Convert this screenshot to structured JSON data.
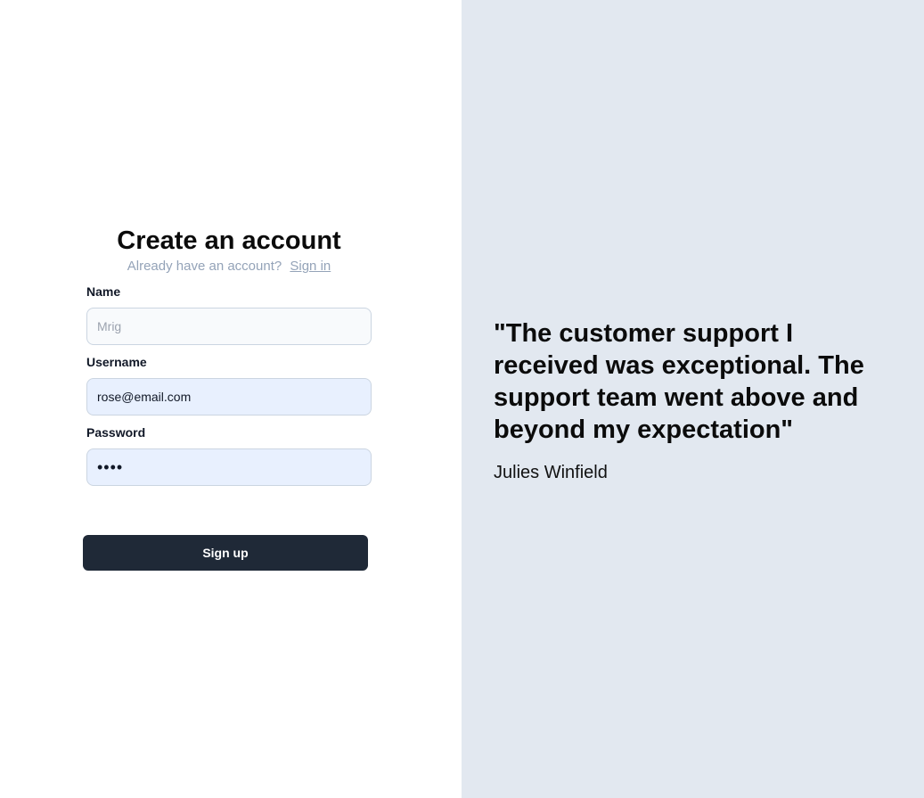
{
  "signup": {
    "title": "Create an account",
    "subtitle_text": "Already have an account?",
    "signin_link": "Sign in",
    "fields": {
      "name": {
        "label": "Name",
        "placeholder": "Mrig",
        "value": ""
      },
      "username": {
        "label": "Username",
        "value": "rose@email.com"
      },
      "password": {
        "label": "Password",
        "value": "1234"
      }
    },
    "submit_label": "Sign up"
  },
  "testimonial": {
    "quote": "\"The customer support I received was exceptional. The support team went above and beyond my expectation\"",
    "author": "Julies Winfield"
  },
  "colors": {
    "left_bg": "#ffffff",
    "right_bg": "#e2e8f0",
    "button_bg": "#1f2937",
    "autofill_bg": "#e8f0fe",
    "muted_text": "#94a3b8"
  }
}
